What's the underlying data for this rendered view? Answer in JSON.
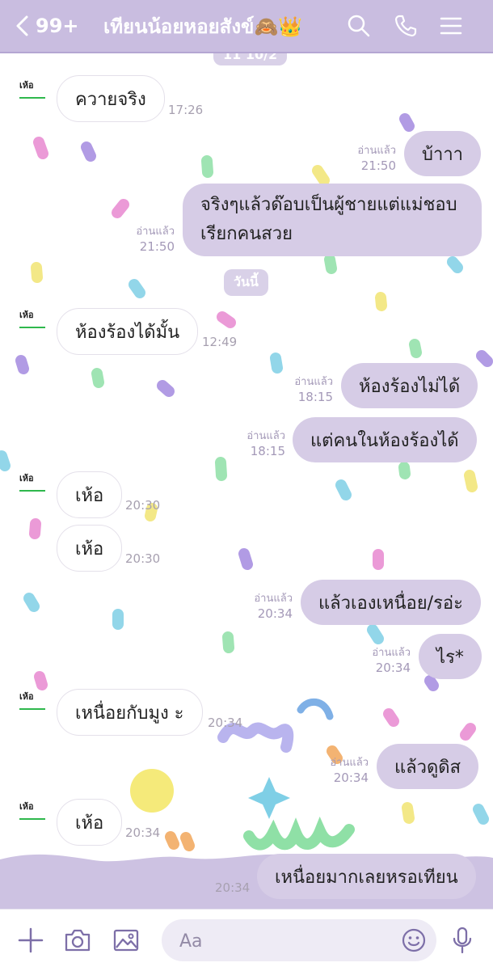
{
  "header": {
    "back_count": "99+",
    "title": "เทียนน้อยหอยสังข์🙈👑",
    "icons": [
      "chevron-left-icon",
      "search-icon",
      "phone-icon",
      "menu-icon"
    ]
  },
  "chat": {
    "top_date_partial": "11 10/2",
    "today_label": "วันนี้",
    "avatar_label": "เห้อ",
    "read_label": "อ่านแล้ว",
    "messages": [
      {
        "side": "in",
        "text": "ควายจริง",
        "time": "17:26"
      },
      {
        "side": "out",
        "text": "บ้าาา",
        "time": "21:50"
      },
      {
        "side": "out",
        "text": "จริงๆแล้วด๊อบเป็นผู้ชายแต่แม่ชอบเรียกคนสวย",
        "time": "21:50"
      },
      {
        "side": "in",
        "text": "ห้องร้องได้มั้น",
        "time": "12:49"
      },
      {
        "side": "out",
        "text": "ห้องร้องไม่ได้",
        "time": "18:15"
      },
      {
        "side": "out",
        "text": "แต่คนในห้องร้องได้",
        "time": "18:15"
      },
      {
        "side": "in",
        "text": "เห้อ",
        "time": "20:30"
      },
      {
        "side": "in",
        "text": "เห้อ",
        "time": "20:30"
      },
      {
        "side": "out",
        "text": "แล้วเองเหนื่อย/รอ่ะ",
        "time": "20:34"
      },
      {
        "side": "out",
        "text": "ไร*",
        "time": "20:34"
      },
      {
        "side": "in",
        "text": "เหนื่อยกับมูง ะ",
        "time": "20:34"
      },
      {
        "side": "out",
        "text": "แล้วดูดิส",
        "time": "20:34"
      },
      {
        "side": "in",
        "text": "เห้อ",
        "time": "20:34"
      },
      {
        "side": "out",
        "text": "เหนื่อยมากเลยหรอเทียน",
        "time": "20:34"
      }
    ]
  },
  "inputbar": {
    "placeholder": "Aa",
    "icons": [
      "plus-icon",
      "camera-icon",
      "image-icon",
      "emoji-icon",
      "microphone-icon"
    ]
  },
  "colors": {
    "header_bg": "#c9bde0",
    "outgoing_bubble": "#d6cce6",
    "incoming_bubble": "#ffffff",
    "accent_green": "#2fb84d"
  }
}
